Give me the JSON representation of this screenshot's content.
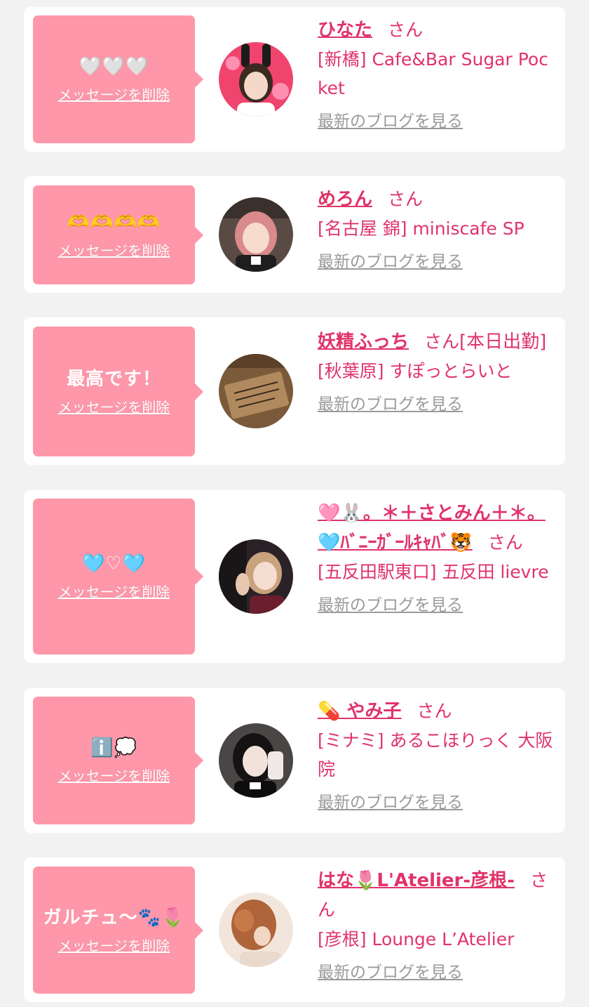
{
  "colors": {
    "background": "#f2f2f2",
    "card": "#ffffff",
    "bubble": "#fd97a9",
    "accent": "#e0336a",
    "link_gray": "#9a9a9a"
  },
  "delete_label": "メッセージを削除",
  "honorific": "さん",
  "blog_label": "最新のブログを見る",
  "cards": [
    {
      "message": "🤍🤍🤍",
      "name": "ひなた",
      "honorific_suffix": "",
      "store": "[新橋] Cafe&Bar Sugar Pocket",
      "avatar_icon": "girl-bunny-ears-photo"
    },
    {
      "message": "🫶🫶🫶🫶",
      "name": "めろん",
      "honorific_suffix": "",
      "store": "[名古屋 錦] miniscafe SP",
      "avatar_icon": "girl-pink-hair-photo"
    },
    {
      "message": "最高です！",
      "name": "妖精ふっち",
      "honorific_suffix": "[本日出勤]",
      "store": "[秋葉原] すぽっとらいと",
      "avatar_icon": "wooden-sign-photo"
    },
    {
      "message": "🩵♡🩵",
      "name": "🩷🐰。＊＋さとみん＋＊。🩵ﾊﾞﾆｰｶﾞｰﾙｷｬﾊﾞ🐯",
      "honorific_suffix": "",
      "store": "[五反田駅東口] 五反田 lievre",
      "avatar_icon": "girl-bunny-costume-photo"
    },
    {
      "message": "ℹ️💭",
      "name": "💊 やみ子",
      "honorific_suffix": "",
      "store": "[ミナミ] あるこほりっく 大阪院",
      "avatar_icon": "girl-dark-hair-photo"
    },
    {
      "message": "ガルチュ〜🐾🌷",
      "name": "はな🌷L'Atelier-彦根-",
      "honorific_suffix": "",
      "store": "[彦根] Lounge L’Atelier",
      "avatar_icon": "girl-brown-hair-photo"
    }
  ]
}
